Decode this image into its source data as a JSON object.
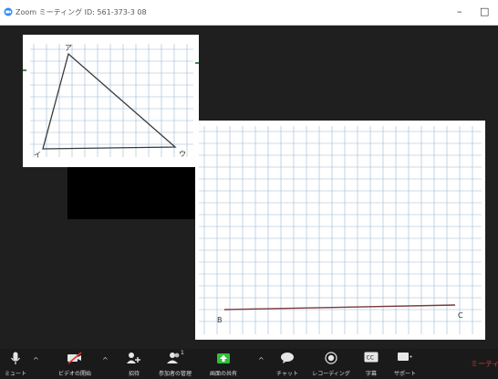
{
  "window": {
    "title": "Zoom ミーティング ID: 561-373-3 08",
    "minimize_glyph": "–",
    "maximize_glyph": "□"
  },
  "shared_content": {
    "triangle_labels": {
      "top": "ア",
      "bottom_left": "イ",
      "bottom_right": "ウ"
    },
    "line_labels": {
      "left": "B",
      "right": "C"
    }
  },
  "toolbar": {
    "mute": "ミュート",
    "video": "ビデオの開始",
    "invite": "招待",
    "participants": "参加者の管理",
    "participants_count": "1",
    "share": "画面の共有",
    "chat": "チャット",
    "record": "レコーディング",
    "captions": "字幕",
    "support": "サポート",
    "end": "ミーティン"
  },
  "colors": {
    "toolbar_bg": "#1a1a1a",
    "stage_bg": "#1f1f1f",
    "share_green": "#2fbf3a",
    "end_red": "#e0362c",
    "grid_line": "#9bb8d6"
  },
  "icons": [
    "zoom-app-icon",
    "microphone-icon",
    "video-off-icon",
    "invite-icon",
    "participants-icon",
    "share-screen-icon",
    "chat-icon",
    "record-icon",
    "captions-icon",
    "support-icon"
  ]
}
